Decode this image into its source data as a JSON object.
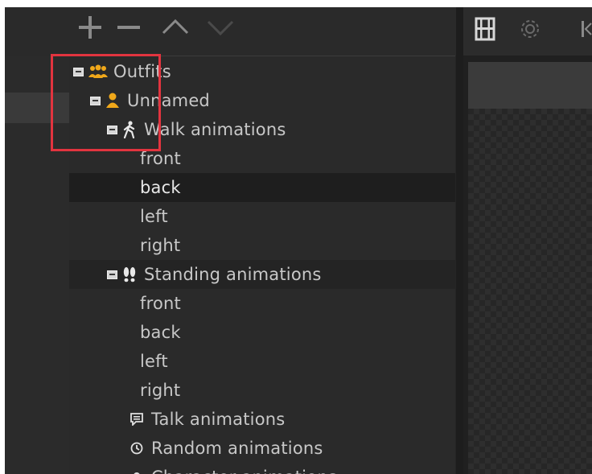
{
  "toolbar": {
    "buttons": [
      {
        "name": "add",
        "icon": "plus-icon"
      },
      {
        "name": "remove",
        "icon": "minus-icon"
      },
      {
        "name": "move-up",
        "icon": "chevron-up-icon"
      },
      {
        "name": "move-down",
        "icon": "chevron-down-icon"
      }
    ]
  },
  "right_toolbar": {
    "icons": [
      "film-icon",
      "gear-icon",
      "skip-back-icon"
    ]
  },
  "tree": {
    "outfits": "Outfits",
    "unnamed": "Unnamed",
    "walk": "Walk animations",
    "walk_front": "front",
    "walk_back": "back",
    "walk_left": "left",
    "walk_right": "right",
    "standing": "Standing animations",
    "stand_front": "front",
    "stand_back": "back",
    "stand_left": "left",
    "stand_right": "right",
    "talk": "Talk animations",
    "random": "Random animations",
    "character": "Character animations"
  },
  "colors": {
    "accent_orange": "#f0a81a",
    "highlight_red": "#e2343f",
    "selected_row": "#1e1e1e"
  }
}
